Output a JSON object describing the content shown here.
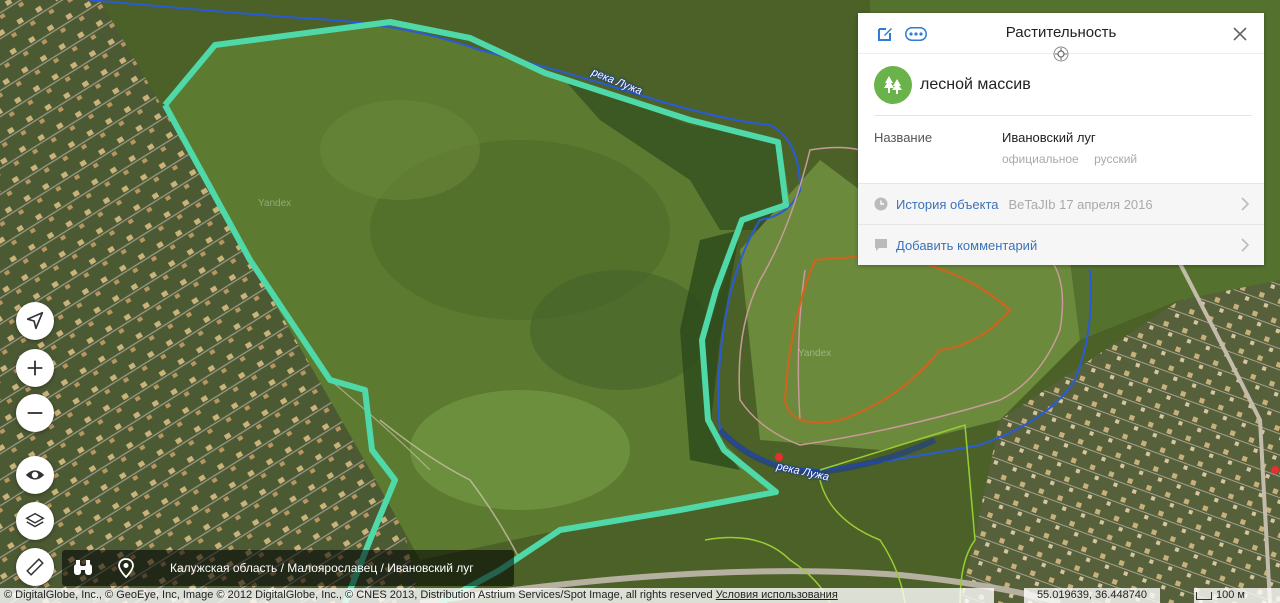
{
  "map": {
    "river_label_1": "река Лужа",
    "river_label_2": "река Лужа",
    "watermark": "Yandex",
    "colors": {
      "highlight": "#4fd9a8",
      "river": "#2a5bd7",
      "path_pink": "#c99a9a",
      "path_orange": "#d4621c",
      "path_green": "#9acd32"
    }
  },
  "controls": {
    "navigate_icon": "navigation-arrow-icon",
    "zoom_in_icon": "plus-icon",
    "zoom_out_icon": "minus-icon",
    "panorama_icon": "eye-icon",
    "layers_icon": "layers-icon",
    "ruler_icon": "ruler-icon",
    "binoculars_icon": "binoculars-icon",
    "pin_icon": "map-pin-icon"
  },
  "breadcrumb": "Калужская область / Малоярославец / Ивановский луг",
  "panel": {
    "title": "Растительность",
    "type": "лесной массив",
    "attr_key": "Название",
    "attr_value": "Ивановский луг",
    "attr_tag_1": "официальное",
    "attr_tag_2": "русский",
    "history_label": "История объекта",
    "history_meta": "BeTaJIb 17 апреля 2016",
    "comment_label": "Добавить комментарий"
  },
  "footer": {
    "attribution": "© DigitalGlobe, Inc., © GeoEye, Inc, Image © 2012 DigitalGlobe, Inc., © CNES 2013, Distribution Astrium Services/Spot Image, all rights reserved",
    "terms_link": "Условия использования",
    "coordinates": "55.019639, 36.448740",
    "scale": "100 м"
  }
}
